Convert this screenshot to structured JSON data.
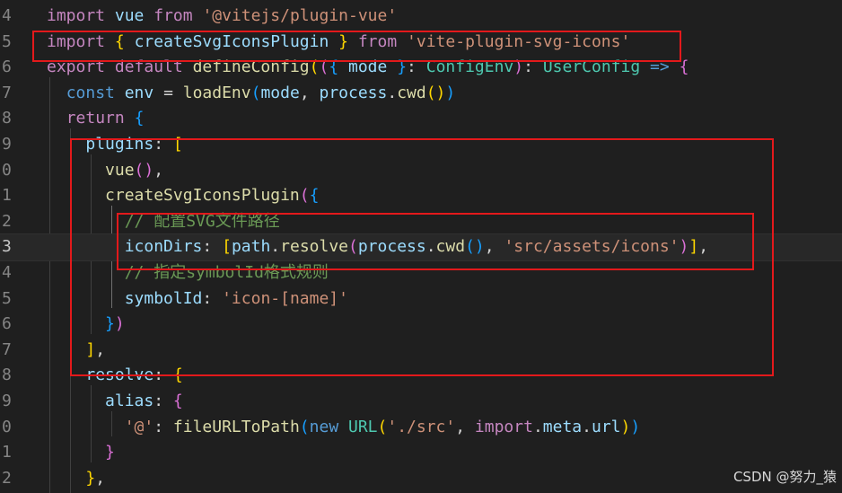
{
  "editor": {
    "line_numbers": [
      "4",
      "5",
      "6",
      "7",
      "8",
      "9",
      "0",
      "1",
      "2",
      "3",
      "4",
      "5",
      "6",
      "7",
      "8",
      "9",
      "0",
      "1",
      "2"
    ],
    "active_line_index": 9
  },
  "lines": [
    [
      {
        "t": "kw",
        "v": "import"
      },
      {
        "t": "pn",
        "v": " "
      },
      {
        "t": "var",
        "v": "vue"
      },
      {
        "t": "pn",
        "v": " "
      },
      {
        "t": "kw",
        "v": "from"
      },
      {
        "t": "pn",
        "v": " "
      },
      {
        "t": "str",
        "v": "'@vitejs/plugin-vue'"
      }
    ],
    [
      {
        "t": "kw",
        "v": "import"
      },
      {
        "t": "pn",
        "v": " "
      },
      {
        "t": "b1",
        "v": "{"
      },
      {
        "t": "pn",
        "v": " "
      },
      {
        "t": "var",
        "v": "createSvgIconsPlugin"
      },
      {
        "t": "pn",
        "v": " "
      },
      {
        "t": "b1",
        "v": "}"
      },
      {
        "t": "pn",
        "v": " "
      },
      {
        "t": "kw",
        "v": "from"
      },
      {
        "t": "pn",
        "v": " "
      },
      {
        "t": "str",
        "v": "'vite-plugin-svg-icons'"
      }
    ],
    [
      {
        "t": "kw",
        "v": "export"
      },
      {
        "t": "pn",
        "v": " "
      },
      {
        "t": "kw",
        "v": "default"
      },
      {
        "t": "pn",
        "v": " "
      },
      {
        "t": "fn",
        "v": "defineConfig"
      },
      {
        "t": "b1",
        "v": "("
      },
      {
        "t": "b2",
        "v": "("
      },
      {
        "t": "b3",
        "v": "{"
      },
      {
        "t": "pn",
        "v": " "
      },
      {
        "t": "var",
        "v": "mode"
      },
      {
        "t": "pn",
        "v": " "
      },
      {
        "t": "b3",
        "v": "}"
      },
      {
        "t": "pn",
        "v": ": "
      },
      {
        "t": "cls",
        "v": "ConfigEnv"
      },
      {
        "t": "b2",
        "v": ")"
      },
      {
        "t": "pn",
        "v": ": "
      },
      {
        "t": "cls",
        "v": "UserConfig"
      },
      {
        "t": "pn",
        "v": " "
      },
      {
        "t": "kw2",
        "v": "=>"
      },
      {
        "t": "pn",
        "v": " "
      },
      {
        "t": "b2",
        "v": "{"
      }
    ],
    [
      {
        "t": "pn",
        "v": "  "
      },
      {
        "t": "kw2",
        "v": "const"
      },
      {
        "t": "pn",
        "v": " "
      },
      {
        "t": "var",
        "v": "env"
      },
      {
        "t": "pn",
        "v": " = "
      },
      {
        "t": "fn",
        "v": "loadEnv"
      },
      {
        "t": "b3",
        "v": "("
      },
      {
        "t": "var",
        "v": "mode"
      },
      {
        "t": "pn",
        "v": ", "
      },
      {
        "t": "var",
        "v": "process"
      },
      {
        "t": "pn",
        "v": "."
      },
      {
        "t": "fn",
        "v": "cwd"
      },
      {
        "t": "b1",
        "v": "()"
      },
      {
        "t": "b3",
        "v": ")"
      }
    ],
    [
      {
        "t": "pn",
        "v": "  "
      },
      {
        "t": "kw",
        "v": "return"
      },
      {
        "t": "pn",
        "v": " "
      },
      {
        "t": "b3",
        "v": "{"
      }
    ],
    [
      {
        "t": "pn",
        "v": "    "
      },
      {
        "t": "var",
        "v": "plugins"
      },
      {
        "t": "pn",
        "v": ": "
      },
      {
        "t": "b1",
        "v": "["
      }
    ],
    [
      {
        "t": "pn",
        "v": "      "
      },
      {
        "t": "fn",
        "v": "vue"
      },
      {
        "t": "b2",
        "v": "()"
      },
      {
        "t": "pn",
        "v": ","
      }
    ],
    [
      {
        "t": "pn",
        "v": "      "
      },
      {
        "t": "fn",
        "v": "createSvgIconsPlugin"
      },
      {
        "t": "b2",
        "v": "("
      },
      {
        "t": "b3",
        "v": "{"
      }
    ],
    [
      {
        "t": "pn",
        "v": "        "
      },
      {
        "t": "cm",
        "v": "// 配置SVG文件路径"
      }
    ],
    [
      {
        "t": "pn",
        "v": "        "
      },
      {
        "t": "var",
        "v": "iconDirs"
      },
      {
        "t": "pn",
        "v": ": "
      },
      {
        "t": "b1",
        "v": "["
      },
      {
        "t": "var",
        "v": "path"
      },
      {
        "t": "pn",
        "v": "."
      },
      {
        "t": "fn",
        "v": "resolve"
      },
      {
        "t": "b2",
        "v": "("
      },
      {
        "t": "var",
        "v": "process"
      },
      {
        "t": "pn",
        "v": "."
      },
      {
        "t": "fn",
        "v": "cwd"
      },
      {
        "t": "b3",
        "v": "()"
      },
      {
        "t": "pn",
        "v": ", "
      },
      {
        "t": "str",
        "v": "'src/assets/icons'"
      },
      {
        "t": "b2",
        "v": ")"
      },
      {
        "t": "b1",
        "v": "]"
      },
      {
        "t": "pn",
        "v": ","
      }
    ],
    [
      {
        "t": "pn",
        "v": "        "
      },
      {
        "t": "cm",
        "v": "// 指定symbolId格式规则"
      }
    ],
    [
      {
        "t": "pn",
        "v": "        "
      },
      {
        "t": "var",
        "v": "symbolId"
      },
      {
        "t": "pn",
        "v": ": "
      },
      {
        "t": "str",
        "v": "'icon-[name]'"
      }
    ],
    [
      {
        "t": "pn",
        "v": "      "
      },
      {
        "t": "b3",
        "v": "}"
      },
      {
        "t": "b2",
        "v": ")"
      }
    ],
    [
      {
        "t": "pn",
        "v": "    "
      },
      {
        "t": "b1",
        "v": "]"
      },
      {
        "t": "pn",
        "v": ","
      }
    ],
    [
      {
        "t": "pn",
        "v": "    "
      },
      {
        "t": "var",
        "v": "resolve"
      },
      {
        "t": "pn",
        "v": ": "
      },
      {
        "t": "b1",
        "v": "{"
      }
    ],
    [
      {
        "t": "pn",
        "v": "      "
      },
      {
        "t": "var",
        "v": "alias"
      },
      {
        "t": "pn",
        "v": ": "
      },
      {
        "t": "b2",
        "v": "{"
      }
    ],
    [
      {
        "t": "pn",
        "v": "        "
      },
      {
        "t": "str",
        "v": "'@'"
      },
      {
        "t": "pn",
        "v": ": "
      },
      {
        "t": "fn",
        "v": "fileURLToPath"
      },
      {
        "t": "b3",
        "v": "("
      },
      {
        "t": "kw2",
        "v": "new"
      },
      {
        "t": "pn",
        "v": " "
      },
      {
        "t": "cls",
        "v": "URL"
      },
      {
        "t": "b1",
        "v": "("
      },
      {
        "t": "str",
        "v": "'./src'"
      },
      {
        "t": "pn",
        "v": ", "
      },
      {
        "t": "kw",
        "v": "import"
      },
      {
        "t": "pn",
        "v": "."
      },
      {
        "t": "var",
        "v": "meta"
      },
      {
        "t": "pn",
        "v": "."
      },
      {
        "t": "var",
        "v": "url"
      },
      {
        "t": "b1",
        "v": ")"
      },
      {
        "t": "b3",
        "v": ")"
      }
    ],
    [
      {
        "t": "pn",
        "v": "      "
      },
      {
        "t": "b2",
        "v": "}"
      }
    ],
    [
      {
        "t": "pn",
        "v": "    "
      },
      {
        "t": "b1",
        "v": "}"
      },
      {
        "t": "pn",
        "v": ","
      }
    ]
  ],
  "watermark": "CSDN @努力_猿",
  "colors": {
    "background": "#1f1f1f",
    "highlight_box": "#e3191b"
  }
}
